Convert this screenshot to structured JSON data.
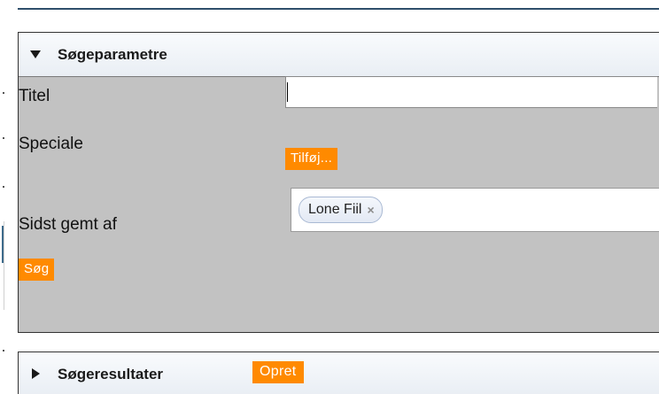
{
  "search_panel": {
    "title": "Søgeparametre",
    "fields": {
      "titel_label": "Titel",
      "titel_value": "",
      "speciale_label": "Speciale",
      "speciale_button": "Tilføj...",
      "sidst_label": "Sidst gemt af",
      "sidst_token": "Lone Fiil",
      "token_remove": "×"
    },
    "search_button": "Søg"
  },
  "results_panel": {
    "title": "Søgeresultater",
    "create_button": "Opret"
  },
  "colors": {
    "accent": "#ff8a00",
    "panel_body": "#c2c2c2",
    "header_line": "#2f4f6b"
  }
}
